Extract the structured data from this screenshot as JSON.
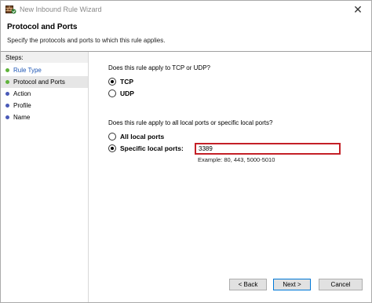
{
  "window": {
    "title": "New Inbound Rule Wizard",
    "close_symbol": "✕"
  },
  "header": {
    "title": "Protocol and Ports",
    "description": "Specify the protocols and ports to which this rule applies."
  },
  "sidebar": {
    "steps_label": "Steps:",
    "items": [
      {
        "label": "Rule Type",
        "state": "done"
      },
      {
        "label": "Protocol and Ports",
        "state": "current"
      },
      {
        "label": "Action",
        "state": "pending"
      },
      {
        "label": "Profile",
        "state": "pending"
      },
      {
        "label": "Name",
        "state": "pending"
      }
    ]
  },
  "protocol": {
    "question": "Does this rule apply to TCP or UDP?",
    "options": [
      {
        "label": "TCP",
        "selected": true
      },
      {
        "label": "UDP",
        "selected": false
      }
    ]
  },
  "ports": {
    "question": "Does this rule apply to all local ports or specific local ports?",
    "options": [
      {
        "label": "All local ports",
        "selected": false
      },
      {
        "label": "Specific local ports:",
        "selected": true
      }
    ],
    "value": "3389",
    "example": "Example: 80, 443, 5000-5010"
  },
  "buttons": {
    "back": "< Back",
    "next": "Next >",
    "cancel": "Cancel"
  },
  "colors": {
    "highlight_border": "#c42027",
    "done_dot": "#5fb33a",
    "pending_dot": "#4a5ab8",
    "link_blue": "#1e56b5"
  },
  "icons": {
    "app": "firewall-rule-icon",
    "close": "close-icon"
  }
}
